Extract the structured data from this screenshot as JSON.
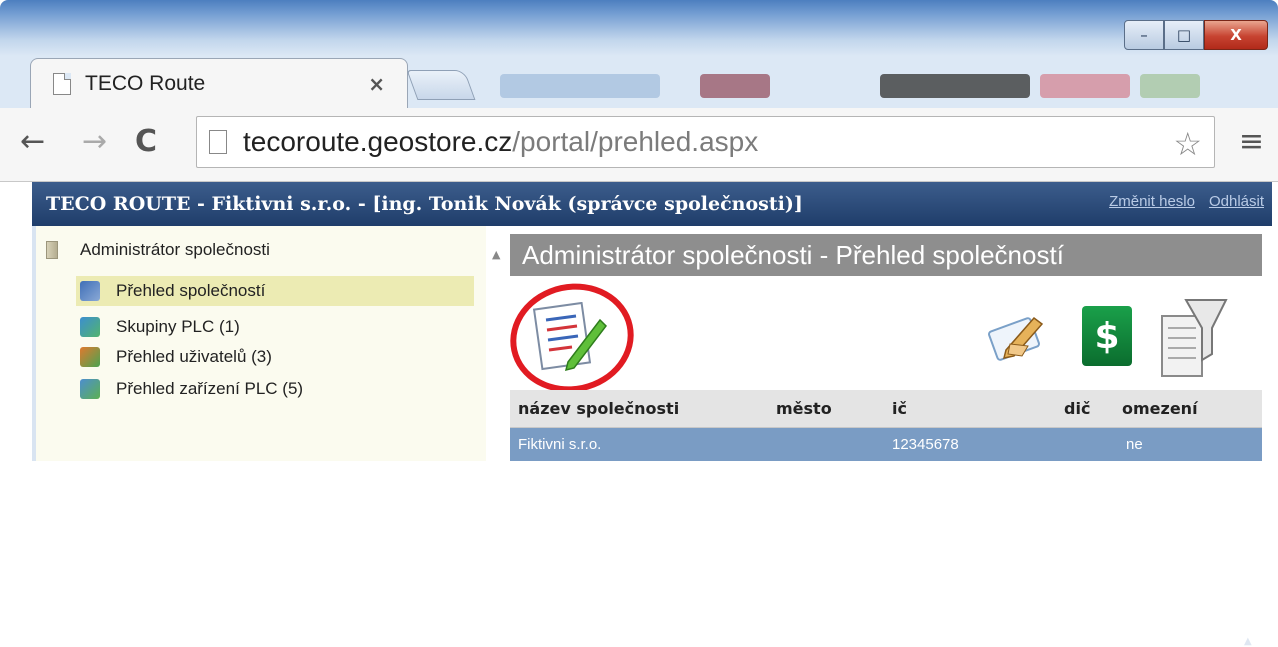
{
  "browser": {
    "tab_title": "TECO Route",
    "tab_close": "×",
    "url_host": "tecoroute.geostore.cz",
    "url_path": "/portal/prehled.aspx",
    "window_controls": {
      "minimize": "–",
      "maximize": "□",
      "close": "X"
    }
  },
  "page": {
    "header_title": "TECO ROUTE - Fiktivni s.r.o. - [ing. Tonik Novák (správce společnosti)]",
    "links": {
      "change_password": "Změnit heslo",
      "logout": "Odhlásit"
    }
  },
  "sidebar": {
    "root_label": "Administrátor společnosti",
    "items": [
      {
        "label": "Přehled společností",
        "icon": "companies-icon",
        "selected": true
      },
      {
        "label": "Skupiny PLC (1)",
        "icon": "plc-groups-icon",
        "selected": false
      },
      {
        "label": "Přehled uživatelů (3)",
        "icon": "users-icon",
        "selected": false
      },
      {
        "label": "Přehled zařízení PLC (5)",
        "icon": "plc-devices-icon",
        "selected": false
      }
    ]
  },
  "content": {
    "title": "Administrátor společnosti - Přehled společností",
    "toolbar_icons": [
      "edit-list-icon",
      "edit-pen-icon",
      "dollar-icon",
      "filter-icon"
    ],
    "table": {
      "columns": [
        "název společnosti",
        "město",
        "ič",
        "dič",
        "omezení"
      ],
      "rows": [
        [
          "Fiktivni s.r.o.",
          "",
          "12345678",
          "",
          "ne"
        ]
      ]
    }
  },
  "colors": {
    "header_bar": "#1f3d6a",
    "title_bar": "#8e8e8e",
    "selected_row": "#7a9cc4",
    "highlight_circle": "#e11b22"
  }
}
